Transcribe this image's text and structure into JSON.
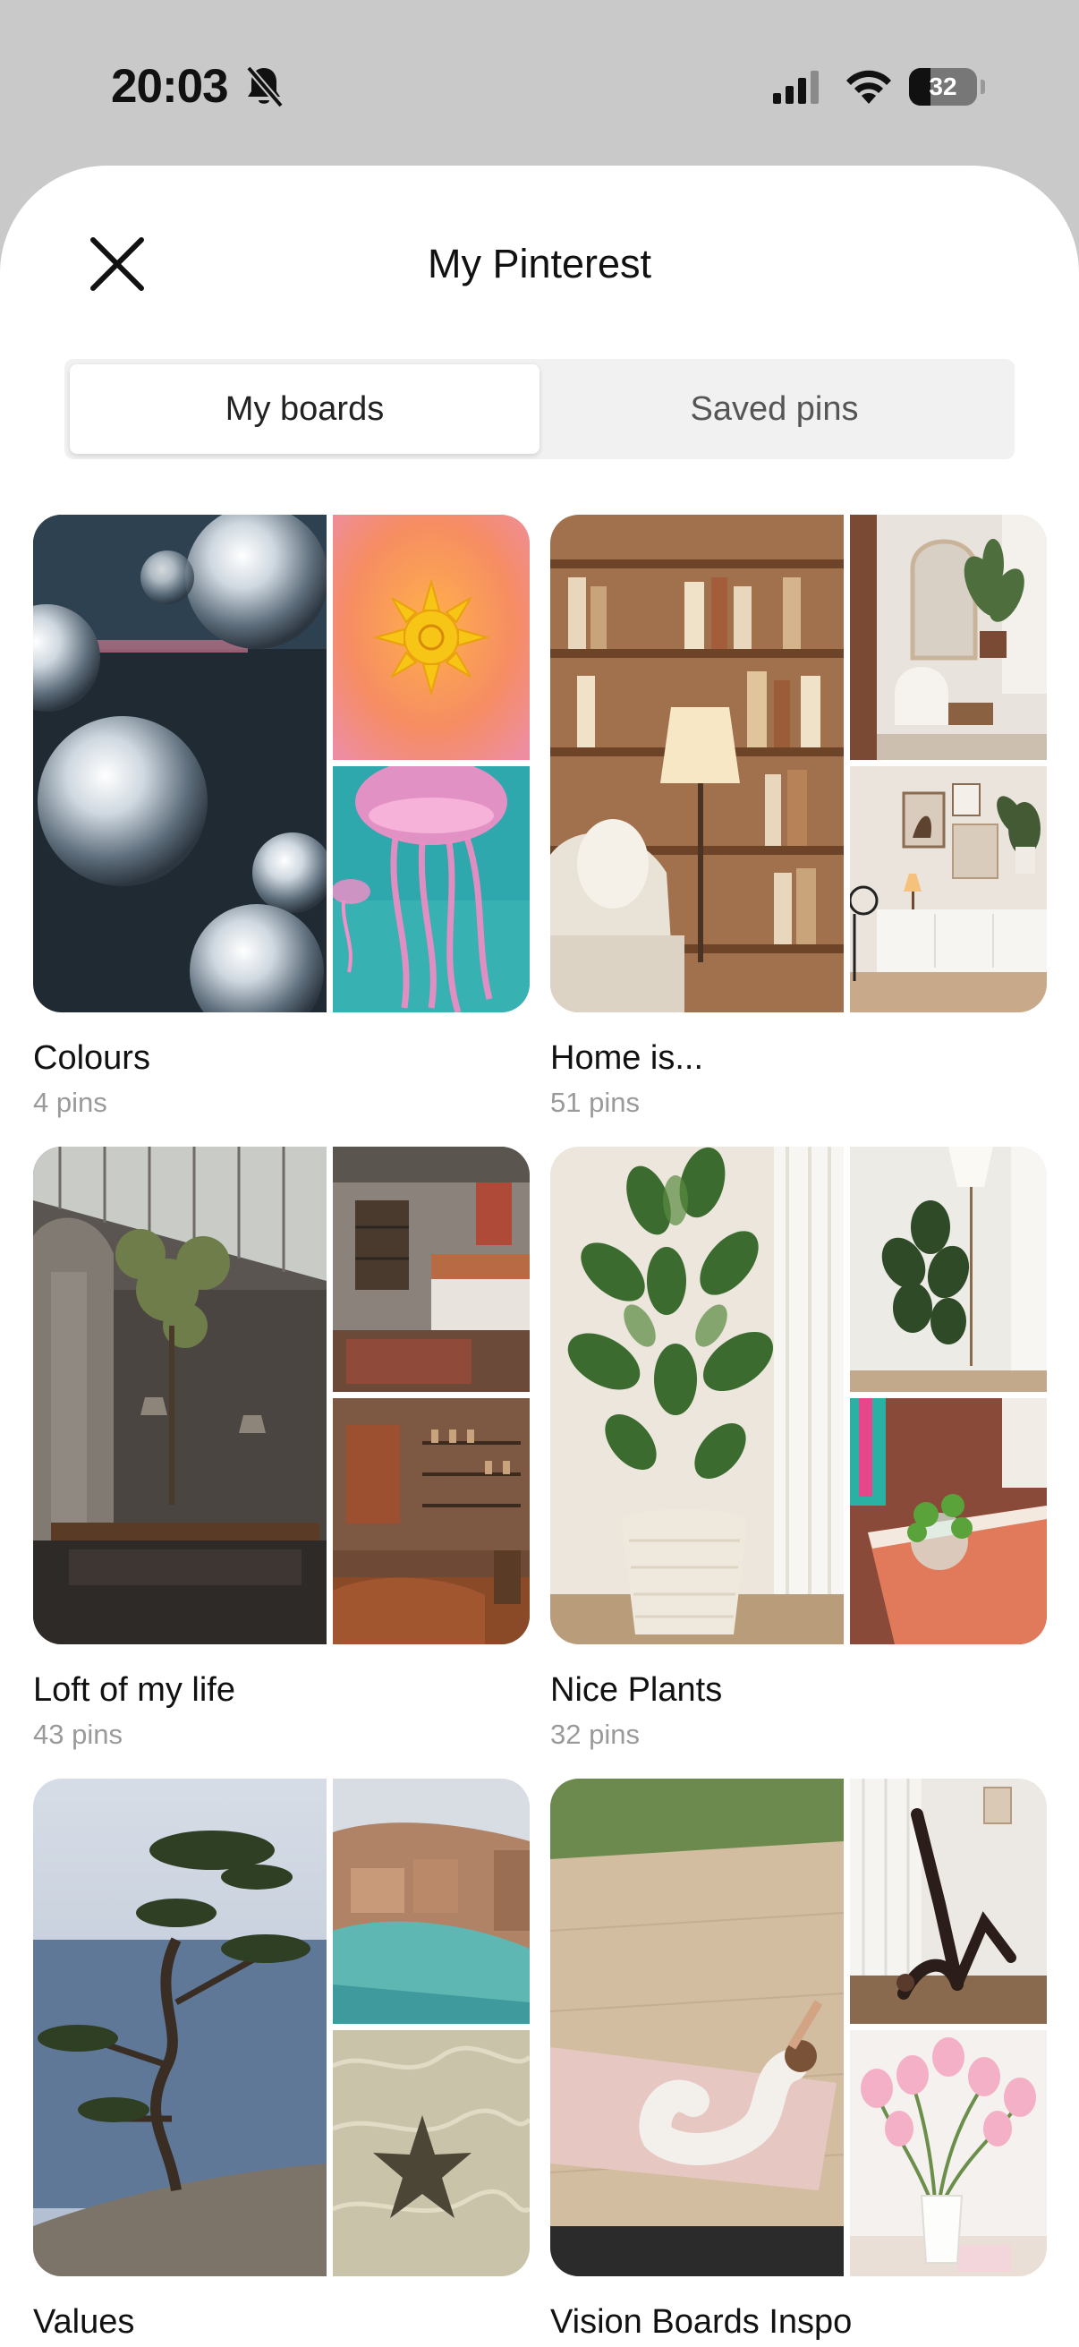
{
  "status_bar": {
    "time": "20:03",
    "battery": "32",
    "battery_level": 0.32,
    "icons": [
      "bell-slash-icon",
      "cellular-signal-icon",
      "wifi-icon",
      "battery-icon"
    ]
  },
  "sheet": {
    "title": "My Pinterest",
    "close_icon": "close-icon"
  },
  "tabs": [
    {
      "label": "My boards",
      "active": true
    },
    {
      "label": "Saved pins",
      "active": false
    }
  ],
  "boards": [
    {
      "title": "Colours",
      "count": "4 pins",
      "images": [
        "disco balls on dark background",
        "sun illustration on orange gradient",
        "pink jellyfish on teal water"
      ]
    },
    {
      "title": "Home is...",
      "count": "51 pins",
      "images": [
        "bookshelves with lamp and armchair",
        "arched mirror with plant and chair",
        "beige room with sideboard and plant"
      ]
    },
    {
      "title": "Loft of my life",
      "count": "43 pins",
      "images": [
        "industrial loft with tree and long table",
        "brick loft bedroom",
        "brick loft living room with leather sofa"
      ]
    },
    {
      "title": "Nice Plants",
      "count": "32 pins",
      "images": [
        "rubber plant in woven basket",
        "fiddle leaf fig by floor lamp",
        "small plant in vase on pink book"
      ]
    },
    {
      "title": "Values",
      "count": "",
      "images": [
        "pine tree over the sea",
        "coastal village and lagoon",
        "starfish in shallow water"
      ]
    },
    {
      "title": "Vision Boards Inspo",
      "count": "",
      "images": [
        "woman stretching on yoga mat",
        "woman doing yoga pose by window",
        "pink tulips in white vase"
      ]
    }
  ]
}
